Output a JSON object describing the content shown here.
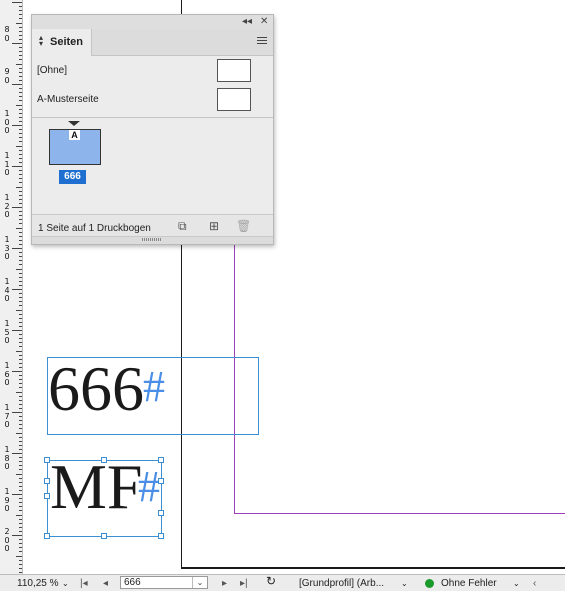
{
  "ruler": {
    "labels": [
      {
        "text": "80"
      },
      {
        "text": "90"
      },
      {
        "text": "100"
      },
      {
        "text": "110"
      },
      {
        "text": "120"
      },
      {
        "text": "130"
      },
      {
        "text": "140"
      },
      {
        "text": "150"
      },
      {
        "text": "160"
      },
      {
        "text": "170"
      },
      {
        "text": "180"
      },
      {
        "text": "190"
      },
      {
        "text": "200"
      }
    ]
  },
  "canvas": {
    "frame1_text": "666",
    "frame1_marker": "#",
    "frame2_text": "MF",
    "frame2_marker": "#",
    "colors": {
      "margin_guide": "#a040b8",
      "frame_border": "#3d8fd1",
      "page_edge": "#1a1a1a"
    }
  },
  "panel": {
    "collapse_glyph": "◂◂",
    "close_glyph": "✕",
    "tab_title": "Seiten",
    "masters": [
      {
        "label": "[Ohne]"
      },
      {
        "label": "A-Musterseite"
      }
    ],
    "page": {
      "prefix": "A",
      "number": "666"
    },
    "footer_status": "1 Seite auf 1 Druckbogen",
    "footer_buttons": {
      "edit_size": "⧉",
      "new_page": "⊞",
      "delete": "🗑"
    }
  },
  "statusbar": {
    "zoom": "110,25 %",
    "page_value": "666",
    "profile": "[Grundprofil] (Arb...",
    "preflight": "Ohne Fehler"
  }
}
